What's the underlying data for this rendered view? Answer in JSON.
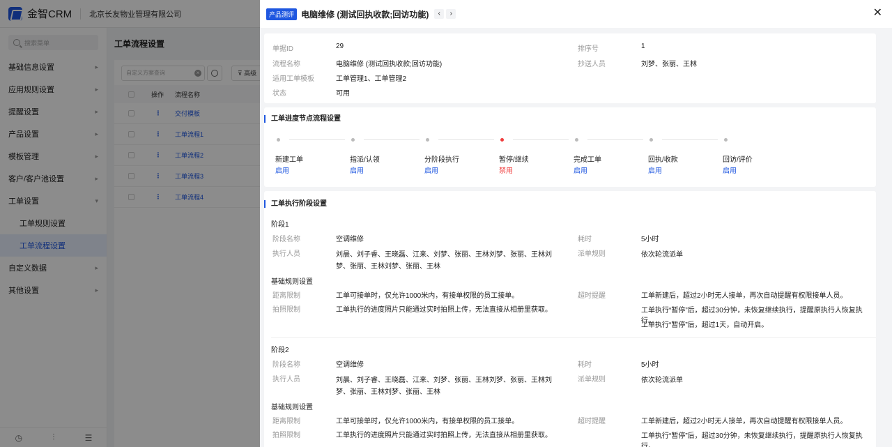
{
  "app": {
    "logo_text": "金智CRM",
    "company": "北京长友物业管理有限公司"
  },
  "sidebar": {
    "search_placeholder": "搜索菜单",
    "items": [
      {
        "label": "基础信息设置",
        "arrow": "▸"
      },
      {
        "label": "应用规则设置",
        "arrow": "▸"
      },
      {
        "label": "提醒设置",
        "arrow": "▸"
      },
      {
        "label": "产品设置",
        "arrow": "▸"
      },
      {
        "label": "模板管理",
        "arrow": "▸"
      },
      {
        "label": "客户/客户池设置",
        "arrow": "▸"
      },
      {
        "label": "工单设置",
        "arrow": "▾"
      },
      {
        "label": "工单规则设置",
        "arrow": ""
      },
      {
        "label": "工单流程设置",
        "arrow": ""
      },
      {
        "label": "自定义数据",
        "arrow": "▸"
      },
      {
        "label": "其他设置",
        "arrow": "▸"
      }
    ],
    "bottom_icons": [
      "history-icon",
      "settings-sliders-icon",
      "menu-collapse-icon"
    ]
  },
  "background_page": {
    "title": "工单流程设置",
    "search_placeholder": "自定义方案查询",
    "clear_glyph": "×",
    "advanced_button": "高级",
    "table_headers": {
      "op": "操作",
      "name": "流程名称"
    },
    "rows": [
      {
        "op": "⋮",
        "name": "交付模板"
      },
      {
        "op": "⋮",
        "name": "工单流程1"
      },
      {
        "op": "⋮",
        "name": "工单流程2"
      },
      {
        "op": "⋮",
        "name": "工单流程3"
      },
      {
        "op": "⋮",
        "name": "工单流程4"
      }
    ]
  },
  "drawer": {
    "tag": "产品测评",
    "title": "电脑维修 (测试回执收款;回访功能)",
    "prev_glyph": "‹",
    "next_glyph": "›",
    "close_glyph": "✕",
    "info": {
      "id_label": "单据ID",
      "id_value": "29",
      "sort_label": "排序号",
      "sort_value": "1",
      "name_label": "流程名称",
      "name_value": "电脑维修 (测试回执收款;回访功能)",
      "cc_label": "抄送人员",
      "cc_value": "刘梦、张丽、王林",
      "template_label": "适用工单模板",
      "template_value": "工单管理1、工单管理2",
      "status_label": "状态",
      "status_value": "可用"
    },
    "progress": {
      "title": "工单进度节点流程设置",
      "steps": [
        {
          "name": "新建工单",
          "status": "启用",
          "enabled": true
        },
        {
          "name": "指派/认领",
          "status": "启用",
          "enabled": true
        },
        {
          "name": "分阶段执行",
          "status": "启用",
          "enabled": true
        },
        {
          "name": "暂停/继续",
          "status": "禁用",
          "enabled": false
        },
        {
          "name": "完成工单",
          "status": "启用",
          "enabled": true
        },
        {
          "name": "回执/收款",
          "status": "启用",
          "enabled": true
        },
        {
          "name": "回访/评价",
          "status": "启用",
          "enabled": true
        }
      ]
    },
    "stages": {
      "title": "工单执行阶段设置",
      "labels": {
        "stage_name": "阶段名称",
        "duration": "耗时",
        "executors": "执行人员",
        "dispatch": "派单规则",
        "basic_rules": "基础规则设置",
        "distance": "距离限制",
        "timeout": "超时提醒",
        "photo": "拍照限制"
      },
      "list": [
        {
          "title": "阶段1",
          "stage_name": "空调维修",
          "duration": "5小时",
          "executors_line1": "刘晨、刘子睿、王晓磊、江来、刘梦、张丽、王林刘梦、张丽、王林刘",
          "executors_line2": "梦、张丽、王林刘梦、张丽、王林",
          "dispatch": "依次轮流派单",
          "distance": "工单可接单时，仅允许1000米内，有接单权限的员工接单。",
          "timeout": "工单新建后，超过2小时无人接单，再次自动提醒有权限接单人员。",
          "photo": "工单执行的进度照片只能通过实时拍照上传，无法直接从相册里获取。",
          "pause_1": "工单执行“暂停”后，超过30分钟，未恢复继续执行，提醒原执行人恢复执行。",
          "pause_2": "工单执行“暂停”后，超过1天，自动开启。"
        },
        {
          "title": "阶段2",
          "stage_name": "空调维修",
          "duration": "5小时",
          "executors_line1": "刘晨、刘子睿、王晓磊、江来、刘梦、张丽、王林刘梦、张丽、王林刘",
          "executors_line2": "梦、张丽、王林刘梦、张丽、王林",
          "dispatch": "依次轮流派单",
          "distance": "工单可接单时，仅允许1000米内，有接单权限的员工接单。",
          "timeout": "工单新建后，超过2小时无人接单，再次自动提醒有权限接单人员。",
          "photo": "工单执行的进度照片只能通过实时拍照上传，无法直接从相册里获取。",
          "pause_1": "工单执行“暂停”后，超过30分钟，未恢复继续执行，提醒原执行人恢复执行。"
        }
      ]
    }
  }
}
